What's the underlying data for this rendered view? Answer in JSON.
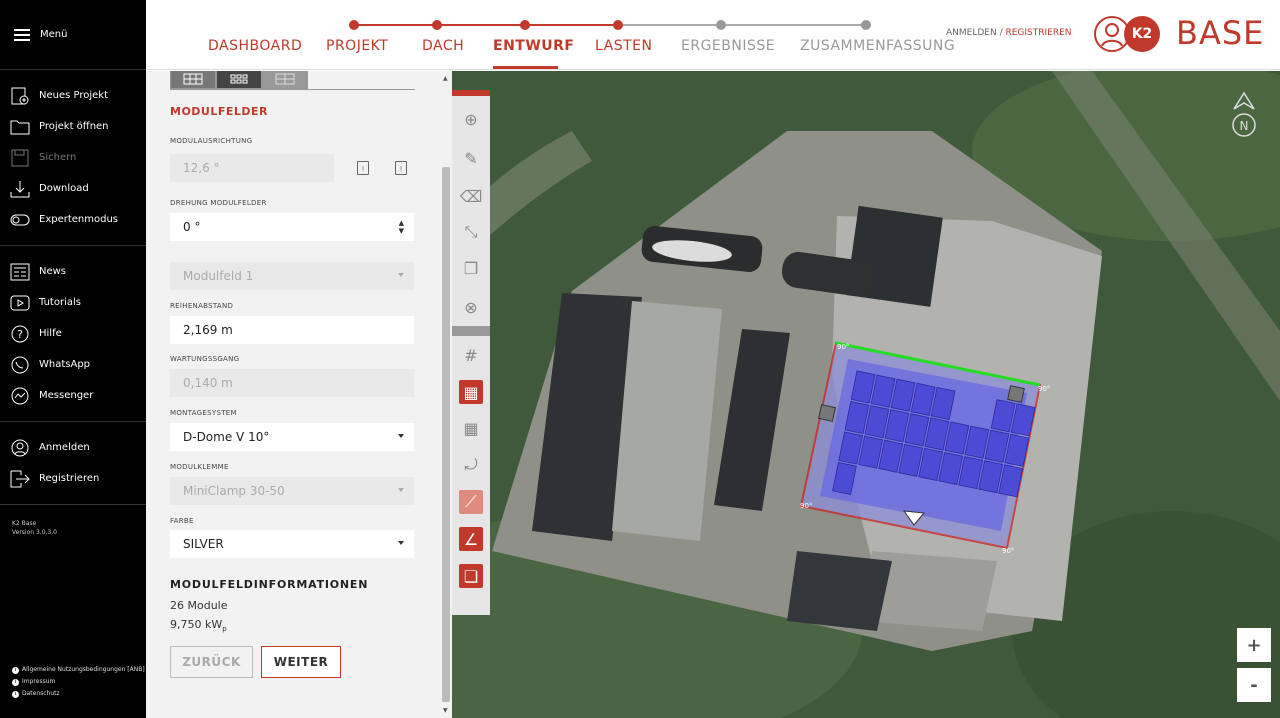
{
  "sidebar": {
    "menu_label": "Menü",
    "group1": [
      {
        "label": "Neues Projekt",
        "icon": "new-project-icon",
        "disabled": false
      },
      {
        "label": "Projekt öffnen",
        "icon": "folder-icon",
        "disabled": false
      },
      {
        "label": "Sichern",
        "icon": "save-icon",
        "disabled": true
      },
      {
        "label": "Download",
        "icon": "download-icon",
        "disabled": false
      },
      {
        "label": "Expertenmodus",
        "icon": "toggle-icon",
        "disabled": false
      }
    ],
    "group2": [
      {
        "label": "News",
        "icon": "news-icon"
      },
      {
        "label": "Tutorials",
        "icon": "play-icon"
      },
      {
        "label": "Hilfe",
        "icon": "help-icon"
      },
      {
        "label": "WhatsApp",
        "icon": "whatsapp-icon"
      },
      {
        "label": "Messenger",
        "icon": "messenger-icon"
      }
    ],
    "group3": [
      {
        "label": "Anmelden",
        "icon": "user-icon"
      },
      {
        "label": "Registrieren",
        "icon": "register-icon"
      }
    ],
    "app_name": "K2 Base",
    "version": "Version 3.0.3.0",
    "legal": [
      "Allgemeine Nutzungsbedingungen [ANB]",
      "Impressum",
      "Datenschutz"
    ]
  },
  "header": {
    "steps": [
      {
        "label": "DASHBOARD",
        "state": "done"
      },
      {
        "label": "PROJEKT",
        "state": "done"
      },
      {
        "label": "DACH",
        "state": "done"
      },
      {
        "label": "ENTWURF",
        "state": "active"
      },
      {
        "label": "LASTEN",
        "state": "done"
      },
      {
        "label": "ERGEBNISSE",
        "state": "future"
      },
      {
        "label": "ZUSAMMENFASSUNG",
        "state": "future"
      }
    ],
    "login": "ANMELDEN",
    "separator": " / ",
    "register": "REGISTRIEREN",
    "brand_badge": "K2",
    "brand": "BASE"
  },
  "panel": {
    "section_title": "MODULFELDER",
    "module_orientation_label": "MODULAUSRICHTUNG",
    "module_orientation_value": "12,6 °",
    "rotation_label": "DREHUNG MODULFELDER",
    "rotation_value": "0 °",
    "module_field_value": "Modulfeld 1",
    "row_spacing_label": "REIHENABSTAND",
    "row_spacing_value": "2,169 m",
    "maintenance_label": "WARTUNGSSGANG",
    "maintenance_value": "0,140 m",
    "mounting_label": "MONTAGESYSTEM",
    "mounting_value": "D-Dome V 10°",
    "clamp_label": "MODULKLEMME",
    "clamp_value": "MiniClamp 30-50",
    "color_label": "FARBE",
    "color_value": "SILVER",
    "info_title": "MODULFELDINFORMATIONEN",
    "info_modules": "26 Module",
    "info_power": "9,750 kW",
    "info_power_sub": "p",
    "back_button": "ZURÜCK",
    "next_button": "WEITER"
  },
  "map": {
    "angle_labels": [
      "90°",
      "90°",
      "90°",
      "90°"
    ],
    "zoom_in": "+",
    "zoom_out": "-",
    "compass_letter": "N"
  },
  "colors": {
    "accent": "#c0392b",
    "module": "#4b4bd6",
    "edge_green": "#22dd22"
  }
}
